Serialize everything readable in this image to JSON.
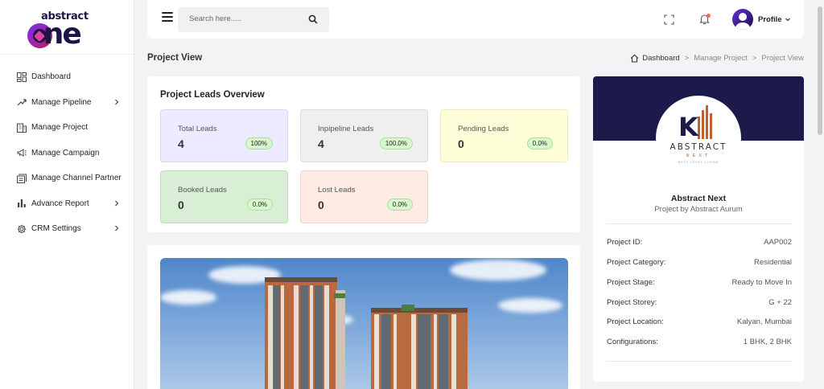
{
  "brand": {
    "logo_top": "abstract",
    "logo_bottom": "one"
  },
  "sidebar": {
    "items": [
      {
        "label": "Dashboard",
        "icon": "dashboard-grid-icon",
        "has_chevron": false
      },
      {
        "label": "Manage Pipeline",
        "icon": "pipeline-icon",
        "has_chevron": true
      },
      {
        "label": "Manage Project",
        "icon": "building-icon",
        "has_chevron": false
      },
      {
        "label": "Manage Campaign",
        "icon": "megaphone-icon",
        "has_chevron": false
      },
      {
        "label": "Manage Channel Partner",
        "icon": "partner-icon",
        "has_chevron": false
      },
      {
        "label": "Advance Report",
        "icon": "bar-chart-icon",
        "has_chevron": true
      },
      {
        "label": "CRM Settings",
        "icon": "gear-icon",
        "has_chevron": true
      }
    ]
  },
  "topbar": {
    "search_placeholder": "Search here.....",
    "profile_label": "Profile"
  },
  "page": {
    "title": "Project View",
    "breadcrumb": [
      "Dashboard",
      "Manage Project",
      "Project View"
    ]
  },
  "overview": {
    "title": "Project Leads Overview",
    "stats": [
      {
        "label": "Total Leads",
        "value": "4",
        "badge": "100%",
        "color": "#ecebff"
      },
      {
        "label": "Inpipeline Leads",
        "value": "4",
        "badge": "100.0%",
        "color": "#efefef"
      },
      {
        "label": "Pending Leads",
        "value": "0",
        "badge": "0.0%",
        "color": "#feffd9"
      },
      {
        "label": "Booked Leads",
        "value": "0",
        "badge": "0.0%",
        "color": "#d8eed5"
      },
      {
        "label": "Lost Leads",
        "value": "0",
        "badge": "0.0%",
        "color": "#feebe3"
      }
    ]
  },
  "project": {
    "logo_brand": "ABSTRACT",
    "logo_sub": "NEXT",
    "logo_tagline": "NEXT LEVEL LIVING",
    "name": "Abstract Next",
    "subtitle": "Project by Abstract Aurum",
    "details": [
      {
        "key": "Project ID:",
        "value": "AAP002"
      },
      {
        "key": "Project Category:",
        "value": "Residential"
      },
      {
        "key": "Project Stage:",
        "value": "Ready to Move In"
      },
      {
        "key": "Project Storey:",
        "value": "G + 22"
      },
      {
        "key": "Project Location:",
        "value": "Kalyan, Mumbai"
      },
      {
        "key": "Configurations:",
        "value": "1 BHK, 2 BHK"
      }
    ]
  },
  "colors": {
    "brand_dark": "#1c1346",
    "banner": "#1c1a4a",
    "badge_green": "#d7f7cc",
    "notification_dot": "#ff6b3d"
  }
}
